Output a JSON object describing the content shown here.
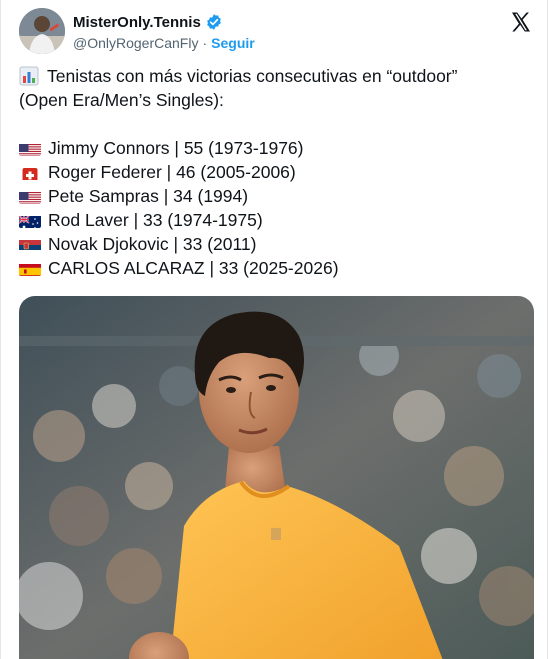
{
  "tweet": {
    "author": {
      "display_name": "MisterOnly.Tennis",
      "handle": "@OnlyRogerCanFly",
      "separator": "·",
      "follow_label": "Seguir",
      "verified_icon": "verified-badge-icon"
    },
    "platform_icon": "x-logo-icon",
    "text": {
      "intro_line_1": "Tenistas con más victorias consecutivas en “outdoor”",
      "intro_line_2": "(Open Era/Men’s Singles):",
      "intro_icon": "bar-chart-emoji-icon",
      "rankings": [
        {
          "flag": "usa-flag-icon",
          "text": "Jimmy Connors | 55 (1973-1976)"
        },
        {
          "flag": "switzerland-flag-icon",
          "text": "Roger Federer | 46 (2005-2006)"
        },
        {
          "flag": "usa-flag-icon",
          "text": "Pete Sampras | 34 (1994)"
        },
        {
          "flag": "australia-flag-icon",
          "text": "Rod Laver | 33 (1974-1975)"
        },
        {
          "flag": "serbia-flag-icon",
          "text": "Novak Djokovic | 33 (2011)"
        },
        {
          "flag": "spain-flag-icon",
          "text": "CARLOS ALCARAZ | 33 (2025-2026)"
        }
      ]
    },
    "media": {
      "type": "photo",
      "subject": "tennis-player-photo"
    },
    "colors": {
      "link": "#1d9bf0",
      "text": "#0f1419",
      "secondary": "#536471",
      "shirt": "#f7b13c"
    }
  }
}
